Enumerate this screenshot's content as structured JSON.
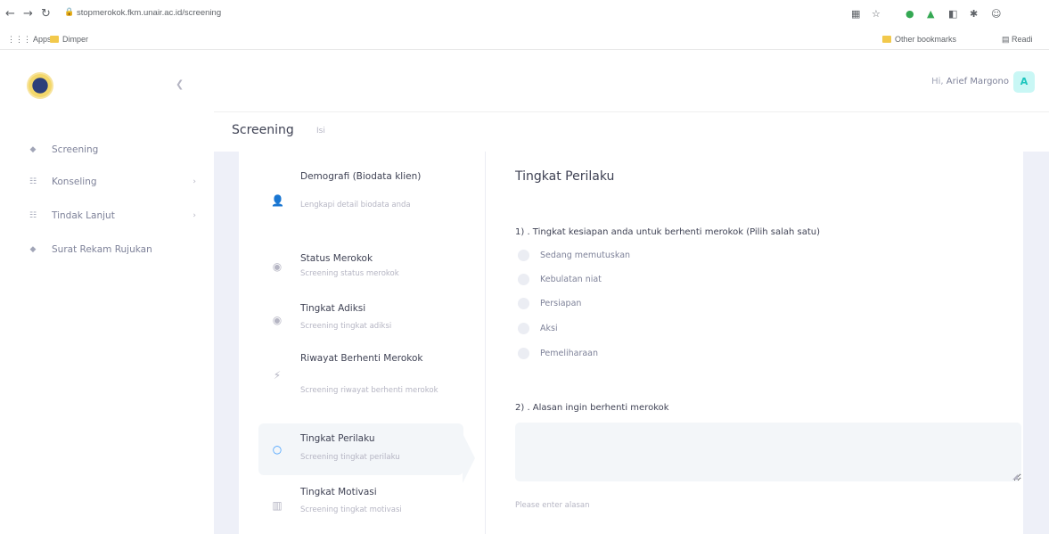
{
  "browser": {
    "url": "stopmerokok.fkm.unair.ac.id/screening",
    "bookmarks": {
      "apps": "Apps",
      "folder": "Dimper",
      "other": "Other bookmarks",
      "reading": "Readi"
    }
  },
  "sidebar": {
    "items": [
      {
        "label": "Screening",
        "icon": "dot-icon",
        "has_chevron": false
      },
      {
        "label": "Konseling",
        "icon": "list-icon",
        "has_chevron": true
      },
      {
        "label": "Tindak Lanjut",
        "icon": "list-icon",
        "has_chevron": true
      },
      {
        "label": "Surat Rekam Rujukan",
        "icon": "dot-icon",
        "has_chevron": false
      }
    ]
  },
  "topbar": {
    "greeting": "Hi,",
    "user_name": "Arief Margono",
    "avatar_letter": "A"
  },
  "subheader": {
    "title": "Screening",
    "subtitle": "Isi"
  },
  "wizard": {
    "steps": [
      {
        "title": "Demografi (Biodata klien)",
        "desc": "Lengkapi detail biodata anda"
      },
      {
        "title": "Status Merokok",
        "desc": "Screening status merokok"
      },
      {
        "title": "Tingkat Adiksi",
        "desc": "Screening tingkat adiksi"
      },
      {
        "title": "Riwayat Berhenti Merokok",
        "desc": "Screening riwayat berhenti merokok"
      },
      {
        "title": "Tingkat Perilaku",
        "desc": "Screening tingkat perilaku"
      },
      {
        "title": "Tingkat Motivasi",
        "desc": "Screening tingkat motivasi"
      }
    ],
    "active_step": 4
  },
  "form": {
    "title": "Tingkat Perilaku",
    "q1": {
      "label": "1) . Tingkat kesiapan anda untuk berhenti merokok (Pilih salah satu)",
      "options": [
        "Sedang memutuskan",
        "Kebulatan niat",
        "Persiapan",
        "Aksi",
        "Pemeliharaan"
      ]
    },
    "q2": {
      "label": "2) . Alasan ingin berhenti merokok",
      "value": "",
      "hint": "Please enter alasan"
    }
  },
  "colors": {
    "accent": "#3699ff",
    "avatar_bg": "#c9f7f5",
    "avatar_fg": "#1bc5bd",
    "content_bg": "#eef0f8"
  }
}
